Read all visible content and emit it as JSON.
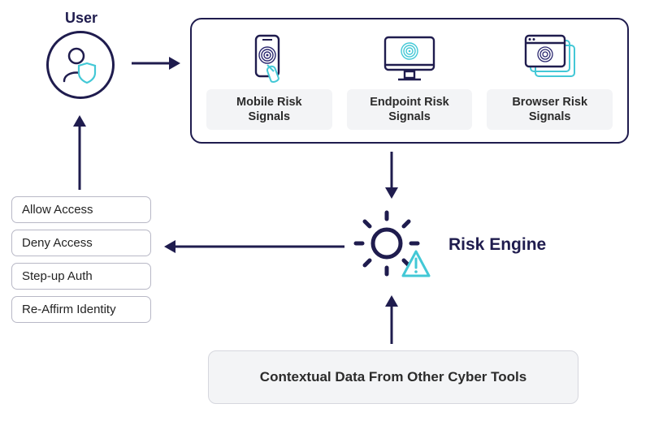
{
  "user": {
    "label": "User"
  },
  "signals": {
    "items": [
      {
        "label": "Mobile Risk Signals"
      },
      {
        "label": "Endpoint Risk Signals"
      },
      {
        "label": "Browser Risk Signals"
      }
    ]
  },
  "actions": {
    "items": [
      {
        "label": "Allow Access"
      },
      {
        "label": "Deny Access"
      },
      {
        "label": "Step-up Auth"
      },
      {
        "label": "Re-Affirm Identity"
      }
    ]
  },
  "risk_engine": {
    "label": "Risk Engine"
  },
  "context": {
    "label": "Contextual Data From Other Cyber Tools"
  }
}
